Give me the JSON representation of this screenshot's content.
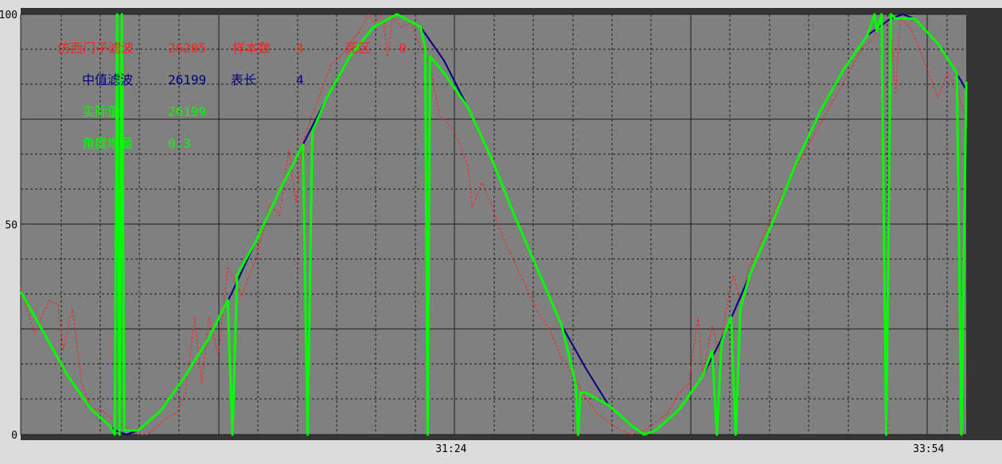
{
  "chart_data": {
    "type": "line",
    "ylim": [
      0,
      100
    ],
    "y_ticks": [
      "100",
      "50",
      "0"
    ],
    "x_tick_labels": [
      "31:24",
      "33:54"
    ],
    "grid": true,
    "colors": {
      "plot_bg": "#808080",
      "outer_bg": "#353535",
      "label_strip": "#dcdcdc",
      "siemens": "#ff2020",
      "median": "#000080",
      "actual": "#00ff00"
    },
    "series": [
      {
        "name": "仿西门子滤波",
        "style": "dashed",
        "points": [
          [
            0,
            35
          ],
          [
            6,
            24
          ],
          [
            12,
            32
          ],
          [
            16,
            31
          ],
          [
            18,
            20
          ],
          [
            22,
            30
          ],
          [
            26,
            12
          ],
          [
            30,
            6
          ],
          [
            34,
            6
          ],
          [
            38,
            4
          ],
          [
            42,
            3
          ],
          [
            46,
            1
          ],
          [
            50,
            0
          ],
          [
            54,
            0
          ],
          [
            58,
            2
          ],
          [
            62,
            4
          ],
          [
            66,
            5
          ],
          [
            70,
            10
          ],
          [
            74,
            28
          ],
          [
            77,
            12
          ],
          [
            80,
            28
          ],
          [
            84,
            19
          ],
          [
            88,
            40
          ],
          [
            94,
            33
          ],
          [
            100,
            42
          ],
          [
            106,
            55
          ],
          [
            110,
            52
          ],
          [
            114,
            68
          ],
          [
            117,
            55
          ],
          [
            120,
            70
          ],
          [
            124,
            76
          ],
          [
            128,
            82
          ],
          [
            132,
            88
          ],
          [
            136,
            90
          ],
          [
            140,
            93
          ],
          [
            144,
            96
          ],
          [
            148,
            100
          ],
          [
            150,
            98
          ],
          [
            154,
            100
          ],
          [
            156,
            90
          ],
          [
            158,
            99
          ],
          [
            162,
            97
          ],
          [
            166,
            98
          ],
          [
            170,
            92
          ],
          [
            174,
            88
          ],
          [
            178,
            76
          ],
          [
            182,
            74
          ],
          [
            186,
            70
          ],
          [
            190,
            64
          ],
          [
            192,
            54
          ],
          [
            196,
            60
          ],
          [
            200,
            55
          ],
          [
            205,
            47
          ],
          [
            210,
            41
          ],
          [
            215,
            35
          ],
          [
            220,
            29
          ],
          [
            225,
            25
          ],
          [
            230,
            18
          ],
          [
            235,
            14
          ],
          [
            240,
            9
          ],
          [
            245,
            5
          ],
          [
            250,
            3
          ],
          [
            255,
            1
          ],
          [
            260,
            0
          ],
          [
            265,
            1
          ],
          [
            270,
            3
          ],
          [
            275,
            5
          ],
          [
            280,
            10
          ],
          [
            284,
            12
          ],
          [
            288,
            28
          ],
          [
            290,
            14
          ],
          [
            294,
            26
          ],
          [
            297,
            20
          ],
          [
            300,
            30
          ],
          [
            303,
            38
          ],
          [
            306,
            32
          ],
          [
            310,
            40
          ],
          [
            314,
            45
          ],
          [
            318,
            50
          ],
          [
            322,
            55
          ],
          [
            326,
            60
          ],
          [
            330,
            64
          ],
          [
            334,
            68
          ],
          [
            338,
            72
          ],
          [
            342,
            76
          ],
          [
            346,
            80
          ],
          [
            350,
            84
          ],
          [
            354,
            88
          ],
          [
            358,
            92
          ],
          [
            362,
            94
          ],
          [
            366,
            98
          ],
          [
            370,
            97
          ],
          [
            372,
            81
          ],
          [
            374,
            99
          ],
          [
            378,
            97
          ],
          [
            382,
            92
          ],
          [
            386,
            86
          ],
          [
            390,
            80
          ],
          [
            394,
            86
          ],
          [
            398,
            82
          ],
          [
            402,
            75
          ]
        ]
      },
      {
        "name": "中值滤波",
        "style": "solid",
        "points": [
          [
            0,
            34
          ],
          [
            10,
            24
          ],
          [
            20,
            14
          ],
          [
            30,
            6
          ],
          [
            40,
            1
          ],
          [
            45,
            0
          ],
          [
            50,
            1
          ],
          [
            60,
            6
          ],
          [
            70,
            14
          ],
          [
            80,
            23
          ],
          [
            90,
            34
          ],
          [
            100,
            46
          ],
          [
            110,
            58
          ],
          [
            120,
            69
          ],
          [
            130,
            80
          ],
          [
            140,
            90
          ],
          [
            150,
            97
          ],
          [
            153,
            98
          ],
          [
            160,
            100
          ],
          [
            170,
            97
          ],
          [
            180,
            89
          ],
          [
            190,
            78
          ],
          [
            200,
            66
          ],
          [
            210,
            52
          ],
          [
            220,
            39
          ],
          [
            230,
            26
          ],
          [
            240,
            16
          ],
          [
            250,
            7
          ],
          [
            260,
            2
          ],
          [
            265,
            0
          ],
          [
            270,
            1
          ],
          [
            280,
            6
          ],
          [
            290,
            14
          ],
          [
            300,
            25
          ],
          [
            310,
            38
          ],
          [
            320,
            51
          ],
          [
            330,
            65
          ],
          [
            340,
            77
          ],
          [
            350,
            87
          ],
          [
            360,
            95
          ],
          [
            370,
            99
          ],
          [
            375,
            100
          ],
          [
            380,
            99
          ],
          [
            390,
            93
          ],
          [
            400,
            84
          ],
          [
            402,
            82
          ]
        ]
      },
      {
        "name": "实际值",
        "style": "solid",
        "points": [
          [
            0,
            34
          ],
          [
            10,
            24
          ],
          [
            20,
            14
          ],
          [
            30,
            6
          ],
          [
            38,
            2
          ],
          [
            40,
            0
          ],
          [
            41,
            100
          ],
          [
            42,
            0
          ],
          [
            43,
            100
          ],
          [
            44,
            1
          ],
          [
            50,
            1
          ],
          [
            60,
            6
          ],
          [
            70,
            14
          ],
          [
            80,
            23
          ],
          [
            88,
            32
          ],
          [
            90,
            0
          ],
          [
            92,
            38
          ],
          [
            100,
            46
          ],
          [
            110,
            58
          ],
          [
            120,
            69
          ],
          [
            122,
            0
          ],
          [
            124,
            72
          ],
          [
            130,
            80
          ],
          [
            140,
            90
          ],
          [
            150,
            97
          ],
          [
            160,
            100
          ],
          [
            170,
            97
          ],
          [
            172,
            92
          ],
          [
            173,
            0
          ],
          [
            174,
            90
          ],
          [
            180,
            86
          ],
          [
            190,
            78
          ],
          [
            200,
            66
          ],
          [
            210,
            52
          ],
          [
            220,
            39
          ],
          [
            230,
            26
          ],
          [
            236,
            12
          ],
          [
            237,
            0
          ],
          [
            238,
            10
          ],
          [
            240,
            10
          ],
          [
            250,
            7
          ],
          [
            260,
            2
          ],
          [
            265,
            0
          ],
          [
            270,
            1
          ],
          [
            280,
            6
          ],
          [
            290,
            14
          ],
          [
            294,
            20
          ],
          [
            296,
            0
          ],
          [
            298,
            22
          ],
          [
            302,
            28
          ],
          [
            304,
            0
          ],
          [
            306,
            30
          ],
          [
            310,
            38
          ],
          [
            320,
            51
          ],
          [
            330,
            65
          ],
          [
            340,
            77
          ],
          [
            350,
            87
          ],
          [
            360,
            95
          ],
          [
            363,
            100
          ],
          [
            364,
            96
          ],
          [
            366,
            100
          ],
          [
            368,
            0
          ],
          [
            370,
            100
          ],
          [
            372,
            99
          ],
          [
            380,
            99
          ],
          [
            390,
            93
          ],
          [
            398,
            86
          ],
          [
            400,
            0
          ],
          [
            402,
            84
          ]
        ]
      }
    ],
    "x_range": [
      0,
      402
    ],
    "x_tick_positions": [
      183,
      386
    ]
  },
  "legend": {
    "row1": {
      "label": "仿西门子滤波",
      "value": "26205",
      "label2": "样本数",
      "value2": "4",
      "label3": "死区",
      "value3": "0"
    },
    "row2": {
      "label": "中值滤波",
      "value": "26199",
      "label2": "表长",
      "value2": "4"
    },
    "row3": {
      "label": "实际值",
      "value": "26199"
    },
    "row4": {
      "label": "角度增量",
      "value": "0.3"
    }
  }
}
